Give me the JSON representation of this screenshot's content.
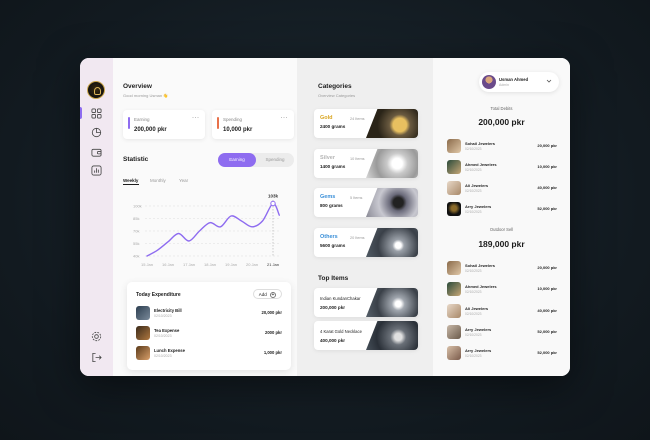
{
  "window": {
    "dots": [
      "#ff5f57",
      "#febc2e",
      "#28c840"
    ]
  },
  "sidebar": {
    "icons": [
      "grid-icon",
      "chart-icon",
      "wallet-icon",
      "report-icon"
    ],
    "bottom_icons": [
      "settings-icon",
      "logout-icon"
    ]
  },
  "overview": {
    "title": "Overview",
    "greeting": "Good morning Usman 👋",
    "earning": {
      "label": "Earning",
      "value": "200,000 pkr",
      "color": "#8e6cf0"
    },
    "spending": {
      "label": "Spending",
      "value": "10,000 pkr",
      "color": "#e8714a"
    }
  },
  "statistic": {
    "title": "Statistic",
    "toggle": [
      "Earning",
      "Spending"
    ],
    "periods": [
      "Weekly",
      "Monthly",
      "Year"
    ]
  },
  "chart_data": {
    "type": "line",
    "x": [
      "15 Jan",
      "16 Jan",
      "17 Jan",
      "18 Jan",
      "19 Jan",
      "20 Jan",
      "21 Jan"
    ],
    "yticks": [
      "100k",
      "85k",
      "70k",
      "55k",
      "40k"
    ],
    "ylim": [
      40,
      100
    ],
    "points": [
      [
        0,
        40
      ],
      [
        0.5,
        47
      ],
      [
        1,
        57
      ],
      [
        1.5,
        67
      ],
      [
        2,
        58
      ],
      [
        2.5,
        70
      ],
      [
        3,
        80
      ],
      [
        3.5,
        75
      ],
      [
        4,
        88
      ],
      [
        4.5,
        82
      ],
      [
        5,
        75
      ],
      [
        5.5,
        82
      ],
      [
        6,
        103
      ],
      [
        6.3,
        89
      ]
    ],
    "peak_label": "103k",
    "highlight_x": "21 Jan",
    "line_color": "#8e6cf0",
    "grid": true
  },
  "expenditure": {
    "title": "Today Expenditure",
    "add_label": "Add",
    "rows": [
      {
        "name": "Electricity Bill",
        "date": "02/10/2023",
        "amount": "20,000 pkr"
      },
      {
        "name": "Tea Expense",
        "date": "02/10/2023",
        "amount": "2000 pkr"
      },
      {
        "name": "Lunch Expense",
        "date": "02/10/2023",
        "amount": "1,000 pkr"
      }
    ]
  },
  "categories": {
    "title": "Categories",
    "subtitle": "Overview Categories",
    "items": [
      {
        "name": "Gold",
        "items": "24 Items",
        "grams": "2400 grams",
        "color": "#d9a520"
      },
      {
        "name": "Silver",
        "items": "10 Items",
        "grams": "1400 grams",
        "color": "#b5b5b5"
      },
      {
        "name": "Gems",
        "items": "5 Items",
        "grams": "800 grams",
        "color": "#3a8fd8"
      },
      {
        "name": "Others",
        "items": "20 Items",
        "grams": "5600 grams",
        "color": "#3a8fd8"
      }
    ]
  },
  "top_items": {
    "title": "Top Items",
    "items": [
      {
        "name": "Indian KundanChakar",
        "price": "200,000 pkr"
      },
      {
        "name": "4 Karat Gold Necklace",
        "price": "400,000 pkr"
      }
    ]
  },
  "user": {
    "name": "Usman Ahmed",
    "role": "Admin"
  },
  "debits": {
    "label": "Total Debits",
    "total": "200,000 pkr",
    "rows": [
      {
        "name": "Sohail Jewelers",
        "date": "02/10/2023",
        "amount": "20,000 pkr"
      },
      {
        "name": "Ahmed Jewelers",
        "date": "02/10/2023",
        "amount": "10,000 pkr"
      },
      {
        "name": "Ali Jewelers",
        "date": "02/10/2023",
        "amount": "40,000 pkr"
      },
      {
        "name": "Arry Jewelers",
        "date": "02/10/2023",
        "amount": "52,000 pkr"
      }
    ]
  },
  "outdoor": {
    "label": "Outdoor Sell",
    "total": "189,000 pkr",
    "rows": [
      {
        "name": "Sohail Jewelers",
        "date": "02/10/2023",
        "amount": "20,000 pkr"
      },
      {
        "name": "Ahmed Jewelers",
        "date": "02/10/2023",
        "amount": "10,000 pkr"
      },
      {
        "name": "Ali Jewelers",
        "date": "02/10/2023",
        "amount": "40,000 pkr"
      },
      {
        "name": "Arry Jewelers",
        "date": "02/10/2023",
        "amount": "52,000 pkr"
      },
      {
        "name": "Arry Jewelers",
        "date": "02/10/2023",
        "amount": "52,000 pkr"
      }
    ]
  }
}
